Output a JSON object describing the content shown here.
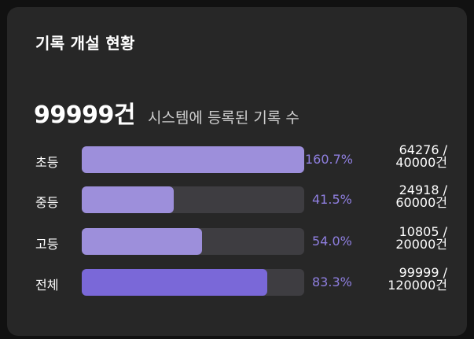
{
  "card": {
    "title": "기록 개설 현황"
  },
  "summary": {
    "count": "99999건",
    "caption": "시스템에 등록된 기록 수"
  },
  "rows": [
    {
      "label": "초등",
      "percent_text": "160.7%",
      "fill_fraction": 1.0,
      "numerator": "64276 /",
      "denominator": "40000건"
    },
    {
      "label": "중등",
      "percent_text": "41.5%",
      "fill_fraction": 0.415,
      "numerator": "24918 /",
      "denominator": "60000건"
    },
    {
      "label": "고등",
      "percent_text": "54.0%",
      "fill_fraction": 0.54,
      "numerator": "10805 /",
      "denominator": "20000건"
    },
    {
      "label": "전체",
      "percent_text": "83.3%",
      "fill_fraction": 0.833,
      "numerator": "99999 /",
      "denominator": "120000건"
    }
  ],
  "colors": {
    "background": "#111111",
    "card": "#272727",
    "track": "#3e3d41",
    "fill": "#9d8fdb",
    "fill_total": "#7a68d8",
    "percent_text": "#8f7fe0"
  }
}
